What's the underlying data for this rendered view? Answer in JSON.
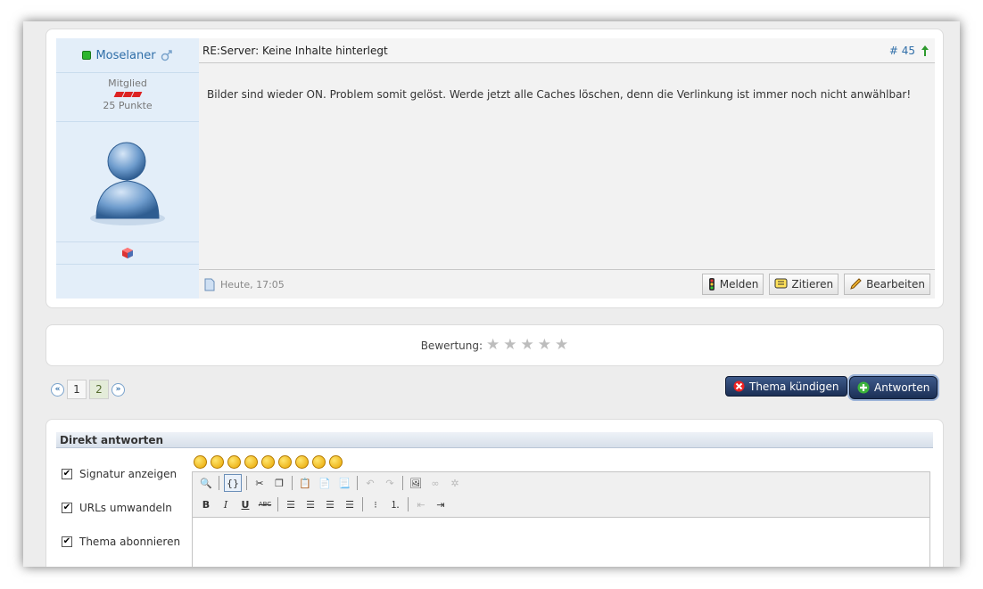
{
  "post": {
    "username": "Moselaner",
    "rank": "Mitglied",
    "points": "25 Punkte",
    "title": "RE:Server: Keine Inhalte hinterlegt",
    "number": "# 45",
    "text": "Bilder sind wieder ON. Problem somit gelöst. Werde jetzt alle Caches löschen, denn die Verlinkung ist immer noch nicht anwählbar!",
    "date": "Heute, 17:05",
    "buttons": {
      "report": "Melden",
      "quote": "Zitieren",
      "edit": "Bearbeiten"
    }
  },
  "rating": {
    "label": "Bewertung:",
    "stars": 0,
    "max": 5
  },
  "pagination": {
    "pages": [
      "1",
      "2"
    ],
    "current": "2"
  },
  "actions": {
    "unsubscribe": "Thema kündigen",
    "reply": "Antworten"
  },
  "reply": {
    "heading": "Direkt antworten",
    "options": [
      {
        "label": "Signatur anzeigen",
        "checked": true
      },
      {
        "label": "URLs umwandeln",
        "checked": true
      },
      {
        "label": "Thema abonnieren",
        "checked": true
      }
    ]
  },
  "colors": {
    "accent": "#2f6ea8",
    "panel": "#e3eef9",
    "button_dark": "#1b2f55"
  }
}
